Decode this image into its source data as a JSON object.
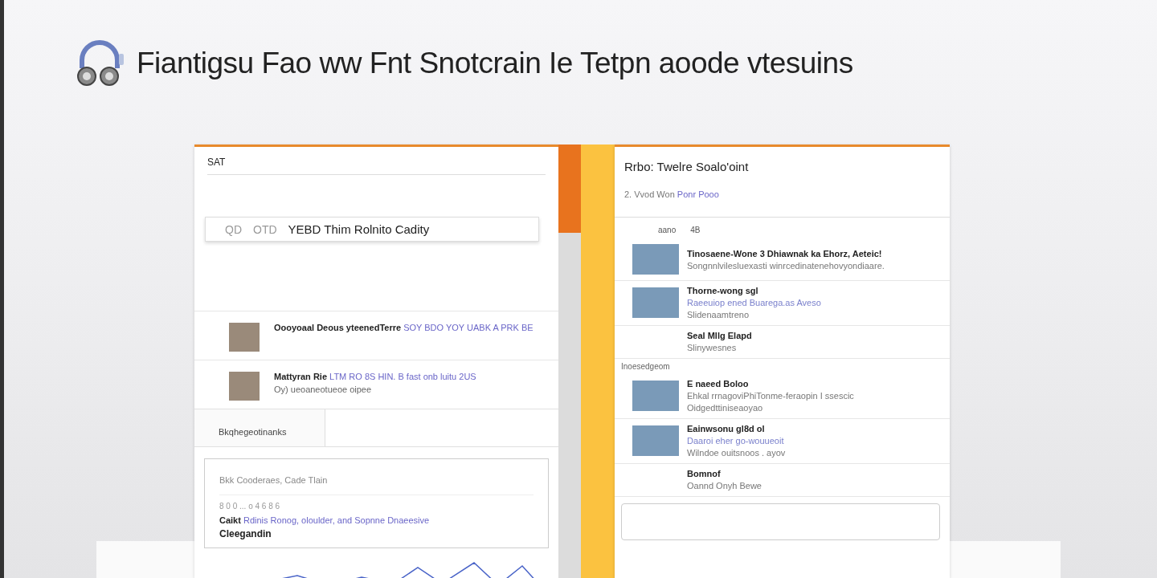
{
  "header": {
    "title": "Fiantigsu Fao ww Fnt Snotcrain Ie Tetpn aoode vtesuins"
  },
  "left_panel": {
    "label": "SAT",
    "search": {
      "value": "YEBD Thim Rolnito Cadity",
      "prefix_1": "QD",
      "prefix_2": "OTD"
    },
    "messages": [
      {
        "sender": "Oooyoaal Deous yteenedTerre",
        "text": "SOY BDO YOY UABK A PRK BE"
      },
      {
        "sender": "Mattyran Rie",
        "text": "LTM RO 8S HIN. B fast onb luitu 2US",
        "preview": "Oy) ueoaneotueoe oipee"
      }
    ],
    "tab": {
      "label": "Bkqhegeotinanks",
      "selected": true
    },
    "card": {
      "title": "Bkk Cooderaes, Cade Tlain",
      "meta": "8 0 0 ... o 4 6 8 6",
      "lead": "Caikt",
      "text": "Rdinis Ronog, oloulder, and Sopnne Dnaeesive",
      "footer": "Cleegandin"
    }
  },
  "right_panel": {
    "title": "Rrbo: Twelre Soalo'oint",
    "subtitle": "2. Vvod Won",
    "subtitle_link": "Ponr Pooo",
    "list_header": [
      "aano",
      "4B"
    ],
    "items": [
      {
        "kind": "photo",
        "title": "Tinosaene-Wone 3 Dhiawnak ka Ehorz, Aeteic!",
        "lines": [
          {
            "text": "Songnnlvilesluexasti winrcedinatenehovyondiaare.",
            "link": false
          }
        ]
      },
      {
        "kind": "photo",
        "title": "Thorne-wong sgl",
        "lines": [
          {
            "text": "Raeeuiop ened Buarega.as Aveso",
            "link": true
          },
          {
            "text": "Slidenaamtreno",
            "link": false
          }
        ]
      },
      {
        "kind": "text",
        "title": "Seal Mllg Elapd",
        "lines": [
          {
            "text": "Slinywesnes",
            "link": false
          }
        ]
      },
      {
        "kind": "section",
        "title": "Inoesedgeom"
      },
      {
        "kind": "photo",
        "title": "E naeed Boloo",
        "lines": [
          {
            "text": "Ehkal rrnagoviPhiTonme-feraopin I ssescic",
            "link": false
          },
          {
            "text": "Oidgedttiniseaoyao",
            "link": false
          }
        ]
      },
      {
        "kind": "photo",
        "title": "Eainwsonu gl8d ol",
        "lines": [
          {
            "text": "Daaroi eher go-wouueoit",
            "link": true
          },
          {
            "text": "Wilndoe ouitsnoos . ayov",
            "link": false
          }
        ]
      },
      {
        "kind": "text",
        "title": "Bomnof",
        "lines": [
          {
            "text": "Oannd Onyh Bewe",
            "link": false
          }
        ]
      }
    ]
  }
}
